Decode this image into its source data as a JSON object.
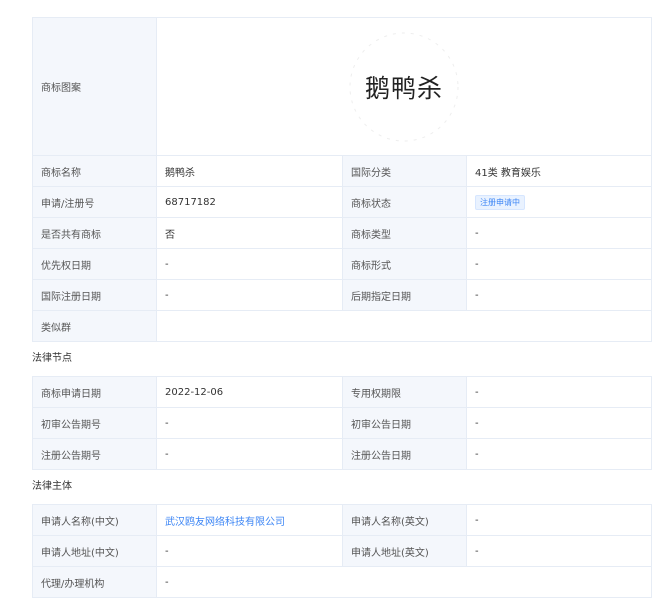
{
  "trademark": {
    "image_label": "商标图案",
    "image_text": "鹅鸭杀",
    "rows": [
      {
        "l1": "商标名称",
        "v1": "鹅鸭杀",
        "l2": "国际分类",
        "v2": "41类 教育娱乐"
      },
      {
        "l1": "申请/注册号",
        "v1": "68717182",
        "l2": "商标状态",
        "v2": "注册申请中"
      },
      {
        "l1": "是否共有商标",
        "v1": "否",
        "l2": "商标类型",
        "v2": "-"
      },
      {
        "l1": "优先权日期",
        "v1": "-",
        "l2": "商标形式",
        "v2": "-"
      },
      {
        "l1": "国际注册日期",
        "v1": "-",
        "l2": "后期指定日期",
        "v2": "-"
      }
    ],
    "similar_group": {
      "label": "类似群",
      "value": ""
    }
  },
  "legal_nodes": {
    "title": "法律节点",
    "rows": [
      {
        "l1": "商标申请日期",
        "v1": "2022-12-06",
        "l2": "专用权期限",
        "v2": "-"
      },
      {
        "l1": "初审公告期号",
        "v1": "-",
        "l2": "初审公告日期",
        "v2": "-"
      },
      {
        "l1": "注册公告期号",
        "v1": "-",
        "l2": "注册公告日期",
        "v2": "-"
      }
    ]
  },
  "legal_subject": {
    "title": "法律主体",
    "rows": [
      {
        "l1": "申请人名称(中文)",
        "v1": "武汉鸥友网络科技有限公司",
        "l2": "申请人名称(英文)",
        "v2": "-"
      },
      {
        "l1": "申请人地址(中文)",
        "v1": "-",
        "l2": "申请人地址(英文)",
        "v2": "-"
      }
    ],
    "agent": {
      "label": "代理/办理机构",
      "value": "-"
    }
  },
  "colors": {
    "label_bg": "#f4f7fc",
    "border": "#e6ecf5",
    "link": "#3d86f5",
    "badge_bg": "#e9f2ff"
  }
}
